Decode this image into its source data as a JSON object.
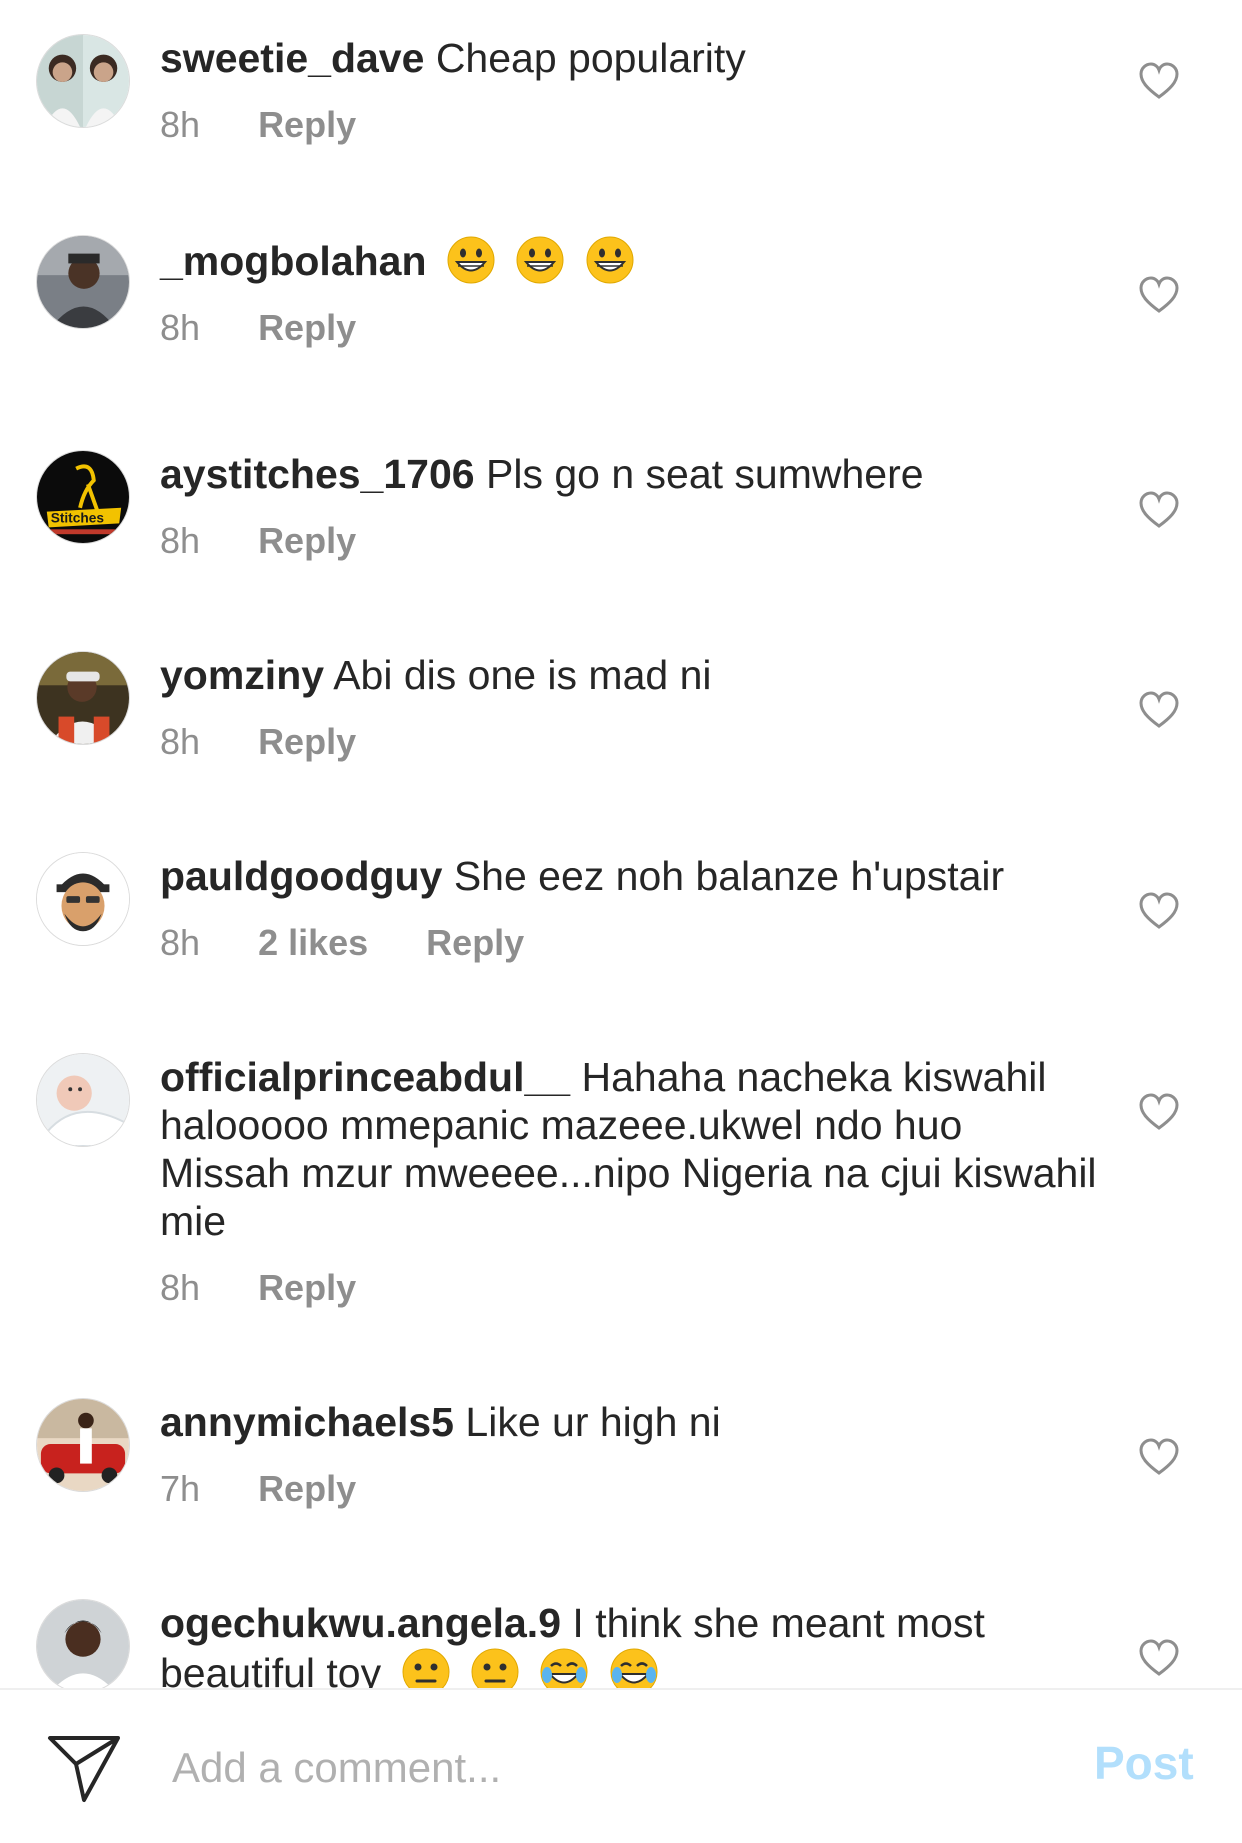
{
  "comments": [
    {
      "username": "sweetie_dave",
      "text": "Cheap popularity",
      "time": "8h",
      "likes": "",
      "reply": "Reply",
      "emojis": []
    },
    {
      "username": "_mogbolahan",
      "text": "",
      "time": "8h",
      "likes": "",
      "reply": "Reply",
      "emojis": [
        "grinning-face",
        "grinning-face",
        "grinning-face"
      ]
    },
    {
      "username": "aystitches_1706",
      "text": "Pls go n seat sumwhere",
      "time": "8h",
      "likes": "",
      "reply": "Reply",
      "emojis": [],
      "avatar_text": "Stitches"
    },
    {
      "username": "yomziny",
      "text": "Abi dis one is mad ni",
      "time": "8h",
      "likes": "",
      "reply": "Reply",
      "emojis": []
    },
    {
      "username": "pauldgoodguy",
      "text": "She eez noh balanze h'upstair",
      "time": "8h",
      "likes": "2 likes",
      "reply": "Reply",
      "emojis": []
    },
    {
      "username": "officialprinceabdul__",
      "text": "Hahaha nacheka kiswahil halooooo mmepanic mazeee.ukwel ndo huo Missah mzur mweeee...nipo Nigeria na cjui kiswahil mie",
      "time": "8h",
      "likes": "",
      "reply": "Reply",
      "emojis": []
    },
    {
      "username": "annymichaels5",
      "text": "Like ur high ni",
      "time": "7h",
      "likes": "",
      "reply": "Reply",
      "emojis": []
    },
    {
      "username": "ogechukwu.angela.9",
      "text": "I think she meant most beautiful toy",
      "time": "",
      "likes": "",
      "reply": "",
      "emojis": [
        "neutral-face",
        "neutral-face",
        "tears-of-joy-face",
        "tears-of-joy-face"
      ]
    }
  ],
  "composer": {
    "placeholder": "Add a comment...",
    "post_label": "Post",
    "icon": "send-icon"
  },
  "colors": {
    "text": "#262626",
    "meta": "#8e8e8e",
    "post_disabled": "#b2dffc",
    "heart_outline": "#8e8e8e"
  }
}
